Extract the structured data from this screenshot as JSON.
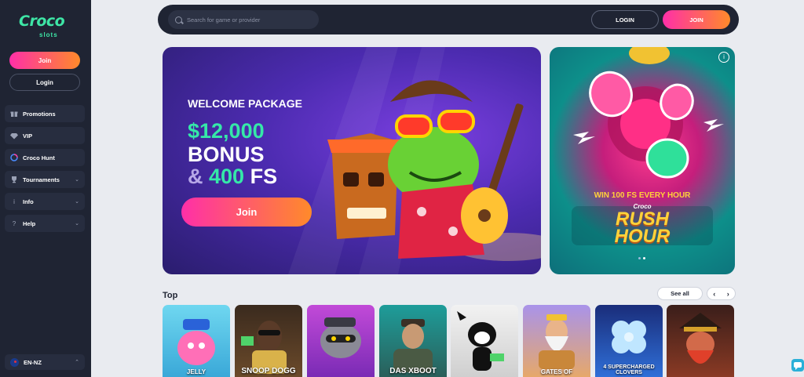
{
  "logo": {
    "main": "Croco",
    "sub": "slots"
  },
  "sidebar": {
    "join_label": "Join",
    "login_label": "Login",
    "items": [
      {
        "label": "Promotions",
        "icon": "gift-icon",
        "chevron": false
      },
      {
        "label": "VIP",
        "icon": "diamond-icon",
        "chevron": false
      },
      {
        "label": "Croco Hunt",
        "icon": "croco-hunt-icon",
        "chevron": false
      },
      {
        "label": "Tournaments",
        "icon": "trophy-icon",
        "chevron": true
      },
      {
        "label": "Info",
        "icon": "info-icon",
        "chevron": true
      },
      {
        "label": "Help",
        "icon": "help-icon",
        "chevron": true
      }
    ],
    "language": "EN-NZ"
  },
  "header": {
    "search_placeholder": "Search for game or provider",
    "login_label": "LOGIN",
    "join_label": "JOIN"
  },
  "hero": {
    "eyebrow": "WELCOME PACKAGE",
    "amount": "$12,000",
    "bonus": "BONUS",
    "amp": "&",
    "fs_value": "400",
    "fs_text": "FS",
    "join_label": "Join"
  },
  "promo": {
    "line": "WIN 100 FS EVERY HOUR",
    "brand": "Croco",
    "title_line1": "RUSH",
    "title_line2": "HOUR"
  },
  "top": {
    "title": "Top",
    "see_all_label": "See all",
    "games": [
      {
        "label": "JELLY",
        "color": "#5cc3e0"
      },
      {
        "label": "SNOOP DOGG",
        "color": "#4a3322"
      },
      {
        "label": "",
        "color": "#b43fd3"
      },
      {
        "label": "DAS XBOOT",
        "color": "#2e6f6a"
      },
      {
        "label": "",
        "color": "#e8e8e8"
      },
      {
        "label": "GATES OF",
        "color": "#8a7ad6"
      },
      {
        "label": "4 SUPERCHARGED CLOVERS",
        "color": "#1f4fa8"
      },
      {
        "label": "",
        "color": "#7a2f1e"
      }
    ]
  },
  "colors": {
    "accent_gradient_start": "#ff2fa8",
    "accent_gradient_end": "#ff8a2a",
    "brand_green": "#3ee6a6",
    "sidebar_bg": "#1f2433"
  }
}
